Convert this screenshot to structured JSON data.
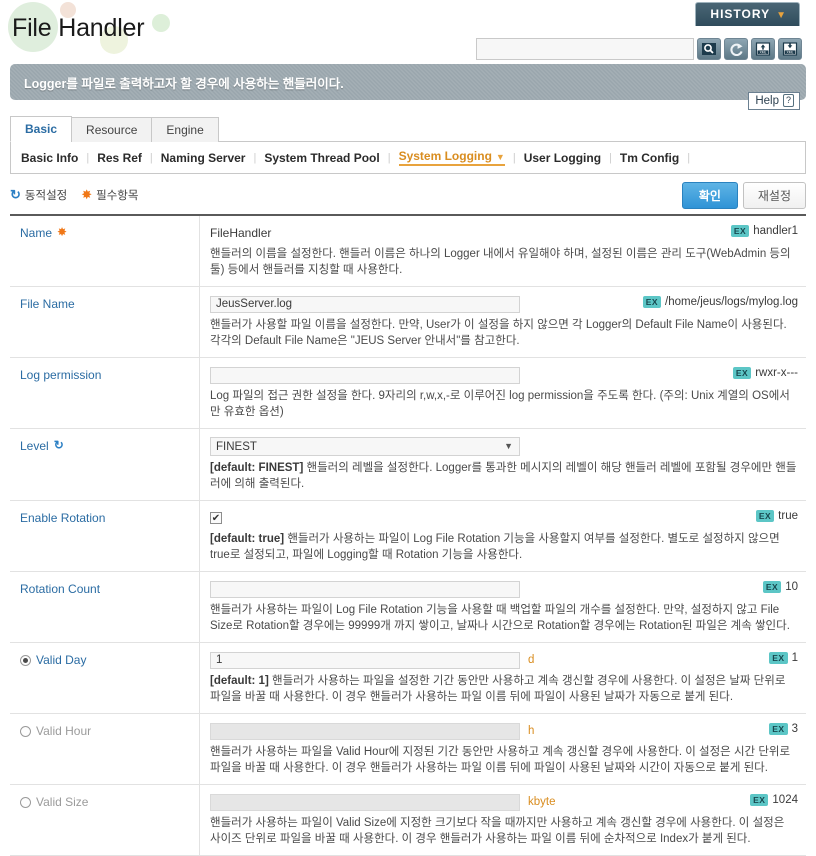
{
  "header": {
    "title": "File Handler",
    "history_label": "HISTORY",
    "history_caret": "▼",
    "search_value": "",
    "search_placeholder": "",
    "icons": [
      {
        "name": "search-icon",
        "title": "Search"
      },
      {
        "name": "refresh-icon",
        "title": "Refresh"
      },
      {
        "name": "xml-import-icon",
        "title": "Import XML"
      },
      {
        "name": "xml-export-icon",
        "title": "Export XML"
      }
    ]
  },
  "banner": {
    "text": "Logger를 파일로 출력하고자 할 경우에 사용하는 핸들러이다.",
    "help_label": "Help",
    "help_mark": "?"
  },
  "tabs": [
    {
      "label": "Basic",
      "active": true
    },
    {
      "label": "Resource",
      "active": false
    },
    {
      "label": "Engine",
      "active": false
    }
  ],
  "subtabs": [
    {
      "label": "Basic Info",
      "active": false,
      "caret": ""
    },
    {
      "label": "Res Ref",
      "active": false,
      "caret": ""
    },
    {
      "label": "Naming Server",
      "active": false,
      "caret": ""
    },
    {
      "label": "System Thread Pool",
      "active": false,
      "caret": ""
    },
    {
      "label": "System Logging",
      "active": true,
      "caret": "▼"
    },
    {
      "label": "User Logging",
      "active": false,
      "caret": ""
    },
    {
      "label": "Tm Config",
      "active": false,
      "caret": ""
    }
  ],
  "actionbar": {
    "legend_dynamic_icon": "↻",
    "legend_dynamic": "동적설정",
    "legend_required_icon": "✸",
    "legend_required": "필수항목",
    "confirm_label": "확인",
    "reset_label": "재설정"
  },
  "ex_badge_label": "EX",
  "fields": [
    {
      "name": "name",
      "label": "Name",
      "required": true,
      "dynamic": false,
      "control": "static",
      "value": "FileHandler",
      "unit": "",
      "disabled": false,
      "example": "handler1",
      "default_tag": "",
      "description": "핸들러의 이름을 설정한다. 핸들러 이름은 하나의 Logger 내에서 유일해야 하며, 설정된 이름은 관리 도구(WebAdmin 등의 툴) 등에서 핸들러를 지칭할 때 사용한다."
    },
    {
      "name": "file-name",
      "label": "File Name",
      "required": false,
      "dynamic": false,
      "control": "text",
      "value": "JeusServer.log",
      "unit": "",
      "disabled": false,
      "example": "/home/jeus/logs/mylog.log",
      "default_tag": "",
      "description": "핸들러가 사용할 파일 이름을 설정한다. 만약, User가 이 설정을 하지 않으면 각 Logger의 Default File Name이 사용된다. 각각의 Default File Name은 \"JEUS Server 안내서\"를 참고한다."
    },
    {
      "name": "log-permission",
      "label": "Log permission",
      "required": false,
      "dynamic": false,
      "control": "text",
      "value": "",
      "unit": "",
      "disabled": false,
      "example": "rwxr-x---",
      "default_tag": "",
      "description": "Log 파일의 접근 권한 설정을 한다. 9자리의 r,w,x,-로 이루어진 log permission을 주도록 한다. (주의: Unix 계열의 OS에서만 유효한 옵션)"
    },
    {
      "name": "level",
      "label": "Level",
      "required": false,
      "dynamic": true,
      "control": "select",
      "value": "FINEST",
      "unit": "",
      "disabled": false,
      "example": "",
      "default_tag": "[default: FINEST]",
      "description": "핸들러의 레벨을 설정한다. Logger를 통과한 메시지의 레벨이 해당 핸들러 레벨에 포함될 경우에만 핸들러에 의해 출력된다."
    },
    {
      "name": "enable-rotation",
      "label": "Enable Rotation",
      "required": false,
      "dynamic": false,
      "control": "checkbox",
      "value": "",
      "checked": true,
      "unit": "",
      "disabled": false,
      "example": "true",
      "default_tag": "[default: true]",
      "description": "핸들러가 사용하는 파일이 Log File Rotation 기능을 사용할지 여부를 설정한다. 별도로 설정하지 않으면 true로 설정되고, 파일에 Logging할 때 Rotation 기능을 사용한다."
    },
    {
      "name": "rotation-count",
      "label": "Rotation Count",
      "required": false,
      "dynamic": false,
      "control": "text",
      "value": "",
      "unit": "",
      "disabled": false,
      "example": "10",
      "default_tag": "",
      "description": "핸들러가 사용하는 파일이 Log File Rotation 기능을 사용할 때 백업할 파일의 개수를 설정한다. 만약, 설정하지 않고 File Size로 Rotation할 경우에는 99999개 까지 쌓이고, 날짜나 시간으로 Rotation할 경우에는 Rotation된 파일은 계속 쌓인다."
    },
    {
      "name": "valid-day",
      "label": "Valid Day",
      "required": false,
      "dynamic": false,
      "radio": true,
      "selected": true,
      "control": "text",
      "value": "1",
      "unit": "d",
      "disabled": false,
      "example": "1",
      "default_tag": "[default: 1]",
      "description": "핸들러가 사용하는 파일을 설정한 기간 동안만 사용하고 계속 갱신할 경우에 사용한다. 이 설정은 날짜 단위로 파일을 바꿀 때 사용한다. 이 경우 핸들러가 사용하는 파일 이름 뒤에 파일이 사용된 날짜가 자동으로 붙게 된다."
    },
    {
      "name": "valid-hour",
      "label": "Valid Hour",
      "required": false,
      "dynamic": false,
      "radio": true,
      "selected": false,
      "control": "text",
      "value": "",
      "unit": "h",
      "disabled": true,
      "example": "3",
      "default_tag": "",
      "description": "핸들러가 사용하는 파일을 Valid Hour에 지정된 기간 동안만 사용하고 계속 갱신할 경우에 사용한다. 이 설정은 시간 단위로 파일을 바꿀 때 사용한다. 이 경우 핸들러가 사용하는 파일 이름 뒤에 파일이 사용된 날짜와 시간이 자동으로 붙게 된다."
    },
    {
      "name": "valid-size",
      "label": "Valid Size",
      "required": false,
      "dynamic": false,
      "radio": true,
      "selected": false,
      "control": "text",
      "value": "",
      "unit": "kbyte",
      "disabled": true,
      "example": "1024",
      "default_tag": "",
      "description": "핸들러가 사용하는 파일이 Valid Size에 지정한 크기보다 작을 때까지만 사용하고 계속 갱신할 경우에 사용한다. 이 설정은 사이즈 단위로 파일을 바꿀 때 사용한다. 이 경우 핸들러가 사용하는 파일 이름 뒤에 순차적으로 Index가 붙게 된다."
    }
  ]
}
